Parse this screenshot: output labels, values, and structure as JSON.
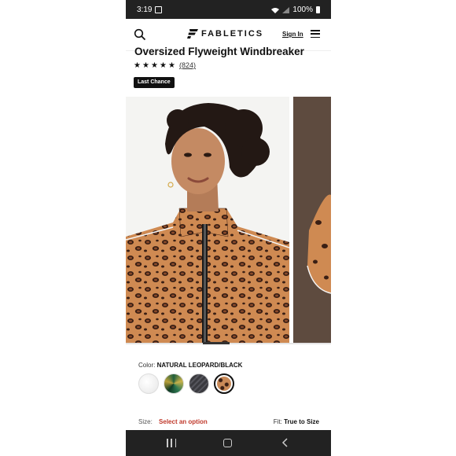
{
  "status": {
    "time": "3:19",
    "battery": "100%"
  },
  "header": {
    "brand": "FABLETICS",
    "signin": "Sign In"
  },
  "product": {
    "title": "Oversized Flyweight Windbreaker",
    "rating_value": 4.5,
    "rating_max": 5,
    "reviews": "(824)",
    "badge": "Last Chance"
  },
  "options": {
    "color_label": "Color:",
    "color_value": "NATURAL LEOPARD/BLACK",
    "swatches": [
      {
        "name": "white",
        "color": "#f2f2f2"
      },
      {
        "name": "green pattern",
        "color": "#2f6b45"
      },
      {
        "name": "black",
        "color": "#3a3a3f"
      },
      {
        "name": "natural leopard",
        "color": "#c98a58"
      }
    ],
    "selected_swatch": 3,
    "size_label": "Size:",
    "size_value": "Select an option",
    "fit_label": "Fit:",
    "fit_value": "True to Size"
  },
  "colors": {
    "accent_red": "#c0392b",
    "dark": "#111111"
  }
}
